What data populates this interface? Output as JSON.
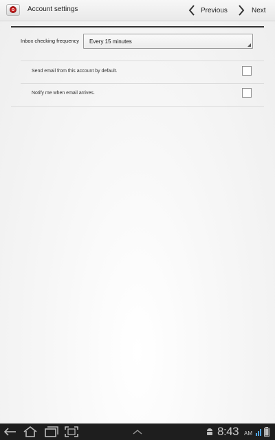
{
  "action_bar": {
    "title": "Account settings",
    "previous_label": "Previous",
    "next_label": "Next"
  },
  "settings": {
    "frequency_label": "Inbox checking frequency",
    "frequency_value": "Every 15 minutes",
    "default_account_label": "Send email from this account by default.",
    "default_account_checked": false,
    "notify_label": "Notify me when email arrives.",
    "notify_checked": false
  },
  "status_bar": {
    "time": "8:43",
    "ampm": "AM"
  },
  "colors": {
    "app_icon_red": "#c21b1b",
    "system_bar": "#1e1e1e"
  }
}
